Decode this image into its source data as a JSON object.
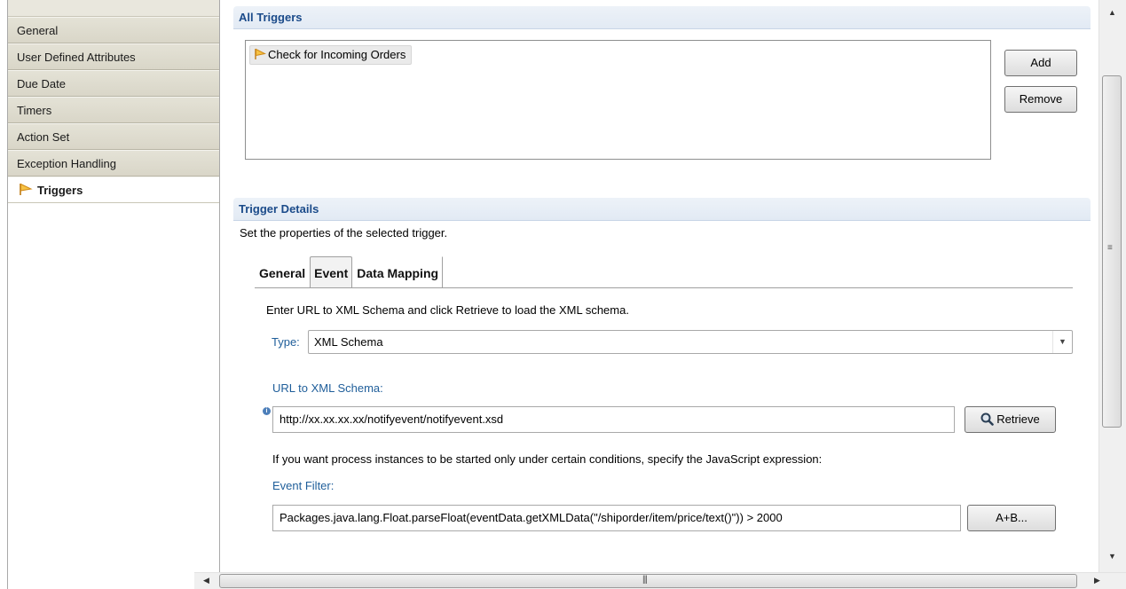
{
  "sidebar": {
    "items": [
      {
        "label": "General"
      },
      {
        "label": "User Defined Attributes"
      },
      {
        "label": "Due Date"
      },
      {
        "label": "Timers"
      },
      {
        "label": "Action Set"
      },
      {
        "label": "Exception Handling"
      },
      {
        "label": "Triggers",
        "active": true
      }
    ]
  },
  "all_triggers": {
    "title": "All Triggers",
    "items": [
      "Check for Incoming Orders"
    ],
    "add_label": "Add",
    "remove_label": "Remove"
  },
  "details": {
    "title": "Trigger Details",
    "description": "Set the properties of the selected trigger.",
    "tabs": [
      {
        "label": "General"
      },
      {
        "label": "Event",
        "selected": true
      },
      {
        "label": "Data Mapping"
      }
    ],
    "event": {
      "instruction": "Enter URL to XML Schema and click Retrieve to load the XML schema.",
      "type_label": "Type:",
      "type_value": "XML Schema",
      "url_label": "URL to XML Schema:",
      "url_value": "http://xx.xx.xx.xx/notifyevent/notifyevent.xsd",
      "retrieve_label": "Retrieve",
      "condition_text": "If you want process instances to be started only under certain conditions, specify the JavaScript expression:",
      "filter_label": "Event Filter:",
      "filter_value": "Packages.java.lang.Float.parseFloat(eventData.getXMLData(\"/shiporder/item/price/text()\")) > 2000",
      "expr_button_label": "A+B..."
    }
  },
  "icons": {
    "trigger": "trigger-flag-icon",
    "retrieve": "magnifier-icon",
    "info": "info-icon"
  },
  "colors": {
    "header_text": "#1b4b8a",
    "label_blue": "#1f5e9a",
    "flag_orange": "#e8a020"
  }
}
